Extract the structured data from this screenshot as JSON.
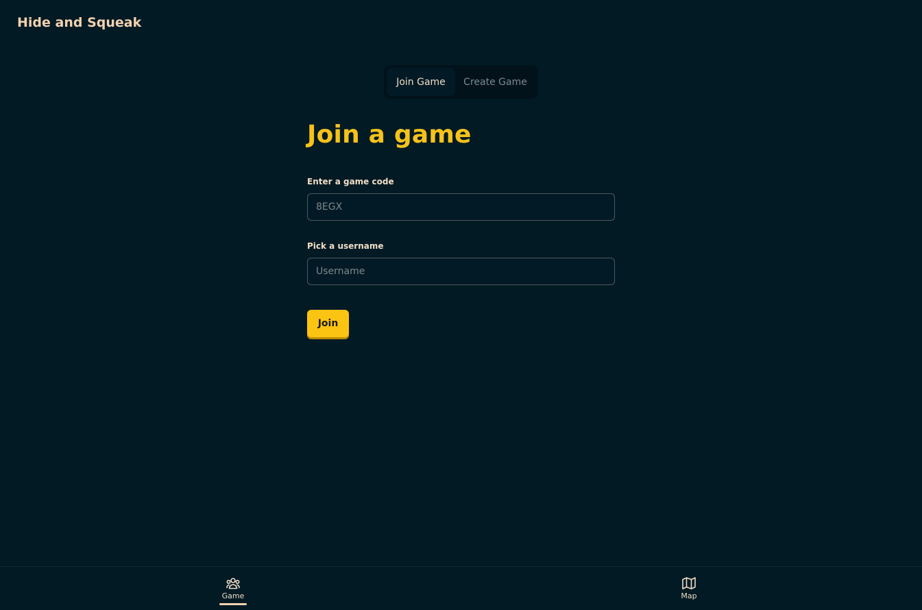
{
  "app": {
    "title": "Hide and Squeak"
  },
  "tabs": {
    "join_label": "Join Game",
    "create_label": "Create Game",
    "active": "join"
  },
  "join_form": {
    "heading": "Join a game",
    "code_label": "Enter a game code",
    "code_placeholder": "8EGX",
    "code_value": "",
    "username_label": "Pick a username",
    "username_placeholder": "Username",
    "username_value": "",
    "submit_label": "Join"
  },
  "bottom_nav": {
    "game_label": "Game",
    "map_label": "Map",
    "active": "game"
  },
  "colors": {
    "background": "#011a24",
    "accent": "#fcc412",
    "title": "#f3d2b0",
    "text": "#f1ddc6"
  },
  "icons": {
    "game": "users-group-icon",
    "map": "map-icon"
  }
}
